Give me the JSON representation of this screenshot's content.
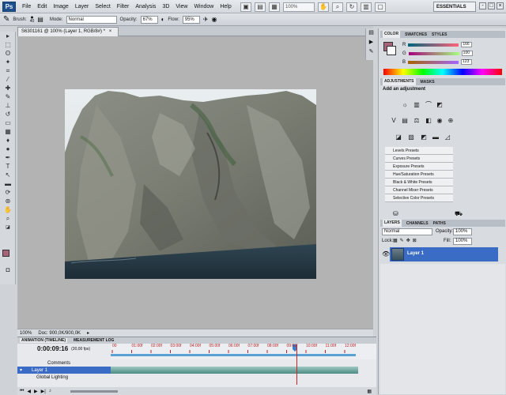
{
  "app": {
    "logo": "Ps"
  },
  "menu": [
    "File",
    "Edit",
    "Image",
    "Layer",
    "Select",
    "Filter",
    "Analysis",
    "3D",
    "View",
    "Window",
    "Help"
  ],
  "appbar": {
    "zoom": "100%"
  },
  "workspace": {
    "label": "ESSENTIALS"
  },
  "options": {
    "brush_label": "Brush:",
    "brush_size": "40",
    "mode_label": "Mode:",
    "mode_value": "Normal",
    "opacity_label": "Opacity:",
    "opacity_value": "67%",
    "flow_label": "Flow:",
    "flow_value": "95%"
  },
  "document": {
    "tab_title": "S6301161 @ 100% (Layer 1, RGB/8#) *",
    "close": "×"
  },
  "status": {
    "zoom": "100%",
    "doc_info": "Doc: 900,0K/900,0K"
  },
  "animation": {
    "tabs": [
      "ANIMATION (TIMELINE)",
      "MEASUREMENT LOG"
    ],
    "timecode": "0:00:09:16",
    "fps": "(30,00 fps)",
    "ruler": [
      "00",
      "01:00f",
      "02:00f",
      "03:00f",
      "04:00f",
      "05:00f",
      "06:00f",
      "07:00f",
      "08:00f",
      "09:00f",
      "10:00f",
      "11:00f",
      "12:00f"
    ],
    "rows": [
      "Comments",
      "Layer 1",
      "Global Lighting"
    ]
  },
  "color_panel": {
    "tabs": [
      "COLOR",
      "SWATCHES",
      "STYLES"
    ],
    "channels": [
      {
        "label": "R",
        "value": "166"
      },
      {
        "label": "G",
        "value": "100"
      },
      {
        "label": "B",
        "value": "123"
      }
    ],
    "fg_color": "#a6647b"
  },
  "adjustments_panel": {
    "tabs": [
      "ADJUSTMENTS",
      "MASKS"
    ],
    "heading": "Add an adjustment",
    "presets": [
      "Levels Presets",
      "Curves Presets",
      "Exposure Presets",
      "Hue/Saturation Presets",
      "Black & White Presets",
      "Channel Mixer Presets",
      "Selective Color Presets"
    ]
  },
  "layers_panel": {
    "tabs": [
      "LAYERS",
      "CHANNELS",
      "PATHS"
    ],
    "blend_mode": "Normal",
    "opacity_label": "Opacity:",
    "opacity_value": "100%",
    "lock_label": "Lock:",
    "fill_label": "Fill:",
    "fill_value": "100%",
    "layers": [
      {
        "name": "Layer 1"
      }
    ]
  },
  "colors": {
    "selection": "#3a6cc5",
    "canvas_bg": "#b3b3b3",
    "accent": "#1f4f8a"
  }
}
